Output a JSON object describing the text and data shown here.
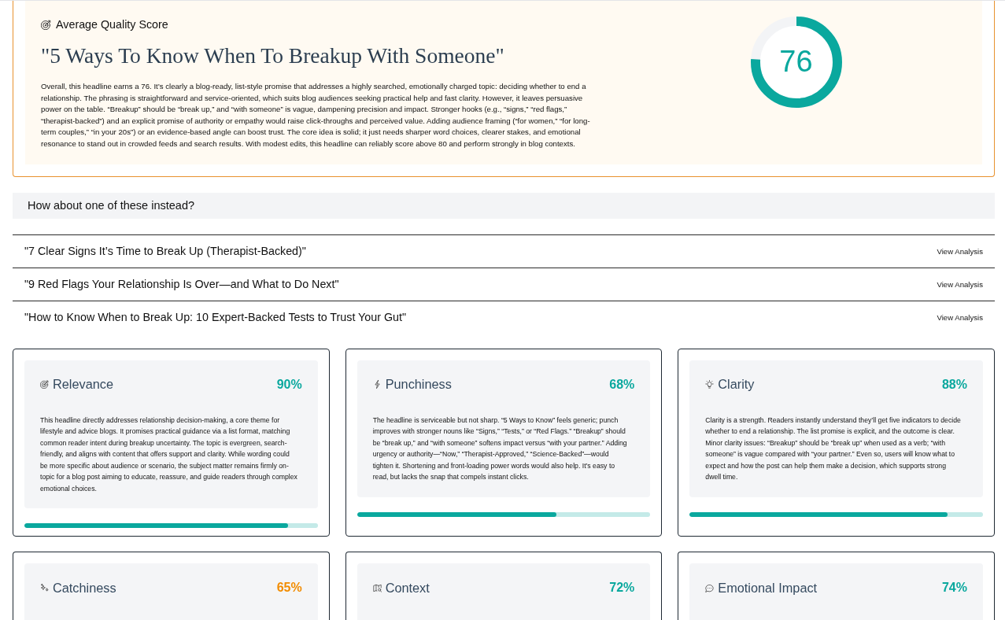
{
  "summary": {
    "label": "Average Quality Score",
    "headline": "\"5 Ways To Know When To Breakup With Someone\"",
    "description": "Overall, this headline earns a 76. It’s clearly a blog-ready, list-style promise that addresses a highly searched, emotionally charged topic: deciding whether to end a relationship. The phrasing is straightforward and service-oriented, which suits blog audiences seeking practical help and fast clarity. However, it leaves persuasive power on the table. “Breakup” should be “break up,” and “with someone” is vague, dampening precision and impact. Stronger hooks (e.g., “signs,” “red flags,” “therapist-backed”) and an explicit promise of authority or empathy would raise click-throughs and perceived value. Adding audience framing (“for women,” “for long-term couples,” “in your 20s”) or an evidence-based angle can boost trust. The core idea is solid; it just needs sharper word choices, clearer stakes, and emotional resonance to stand out in crowded feeds and search results. With modest edits, this headline can reliably score above 80 and perform strongly in blog contexts.",
    "score": "76",
    "level": 0.76
  },
  "alternatives": {
    "prompt": "How about one of these instead?",
    "items": [
      {
        "headline": "\"7 Clear Signs It’s Time to Break Up (Therapist-Backed)\"",
        "action": "View Analysis"
      },
      {
        "headline": "\"9 Red Flags Your Relationship Is Over—and What to Do Next\"",
        "action": "View Analysis"
      },
      {
        "headline": "\"How to Know When to Break Up: 10 Expert-Backed Tests to Trust Your Gut\"",
        "action": "View Analysis"
      }
    ]
  },
  "criteria": [
    {
      "name": "Relevance",
      "score": "90%",
      "color": "#0aa89e",
      "description": "This headline directly addresses relationship decision-making, a core theme for lifestyle and advice blogs. It promises practical guidance via a list format, matching common reader intent during breakup uncertainty. The topic is evergreen, search-friendly, and aligns with content that offers support and clarity. While wording could be more specific about audience or scenario, the subject matter remains firmly on-topic for a blog post aiming to educate, reassure, and guide readers through complex emotional choices.",
      "level": 0.9
    },
    {
      "name": "Punchiness",
      "score": "68%",
      "color": "#0aa89e",
      "description": "The headline is serviceable but not sharp. “5 Ways to Know” feels generic; punch improves with stronger nouns like “Signs,” “Tests,” or “Red Flags.” “Breakup” should be “break up,” and “with someone” softens impact versus “with your partner.” Adding urgency or authority—“Now,” “Therapist-Approved,” “Science-Backed”—would tighten it. Shortening and front-loading power words would also help. It’s easy to read, but lacks the snap that compels instant clicks.",
      "level": 0.68
    },
    {
      "name": "Clarity",
      "score": "88%",
      "color": "#0aa89e",
      "description": "Clarity is a strength. Readers instantly understand they’ll get five indicators to decide whether to end a relationship. The list promise is explicit, and the outcome is clear. Minor clarity issues: “Breakup” should be “break up” when used as a verb; “with someone” is vague compared with “your partner.” Even so, users will know what to expect and how the post can help them make a decision, which supports strong dwell time.",
      "level": 0.88
    },
    {
      "name": "Catchiness",
      "score": "65%",
      "color": "#f28c00"
    },
    {
      "name": "Context",
      "score": "72%",
      "color": "#0aa89e"
    },
    {
      "name": "Emotional Impact",
      "score": "74%",
      "color": "#0aa89e"
    }
  ]
}
